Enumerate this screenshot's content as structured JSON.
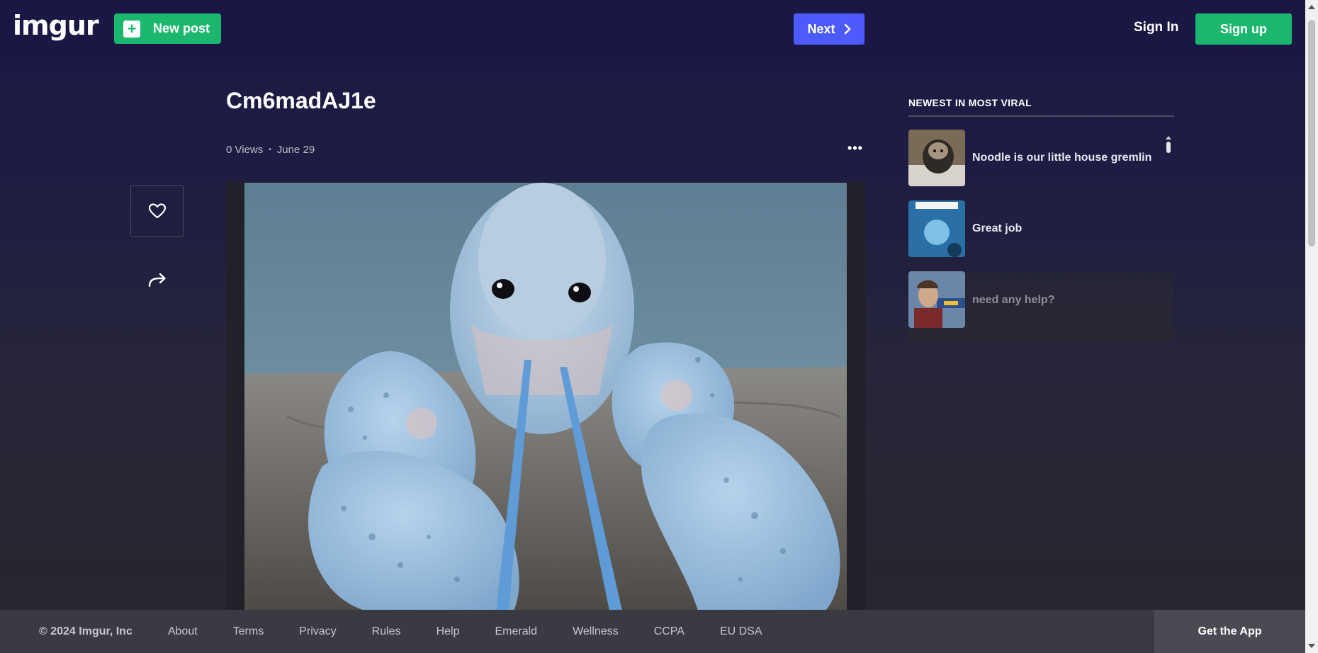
{
  "header": {
    "logo": "imgur",
    "new_post_label": "New post",
    "next_label": "Next",
    "sign_in_label": "Sign In",
    "sign_up_label": "Sign up"
  },
  "post": {
    "title": "Cm6madAJ1e",
    "views": "0 Views",
    "date": "June 29",
    "more_label": "•••"
  },
  "sidebar": {
    "heading": "NEWEST IN MOST VIRAL",
    "items": [
      {
        "title": "Noodle is our little house gremlin"
      },
      {
        "title": "Great job"
      },
      {
        "title": "need any help?"
      }
    ]
  },
  "footer": {
    "copyright": "© 2024 Imgur, Inc",
    "links": [
      "About",
      "Terms",
      "Privacy",
      "Rules",
      "Help",
      "Emerald",
      "Wellness",
      "CCPA",
      "EU DSA"
    ],
    "get_app_label": "Get the App"
  },
  "colors": {
    "green": "#1bb76e",
    "next_blue": "#4d5afd",
    "header_bg": "#1a1744"
  }
}
